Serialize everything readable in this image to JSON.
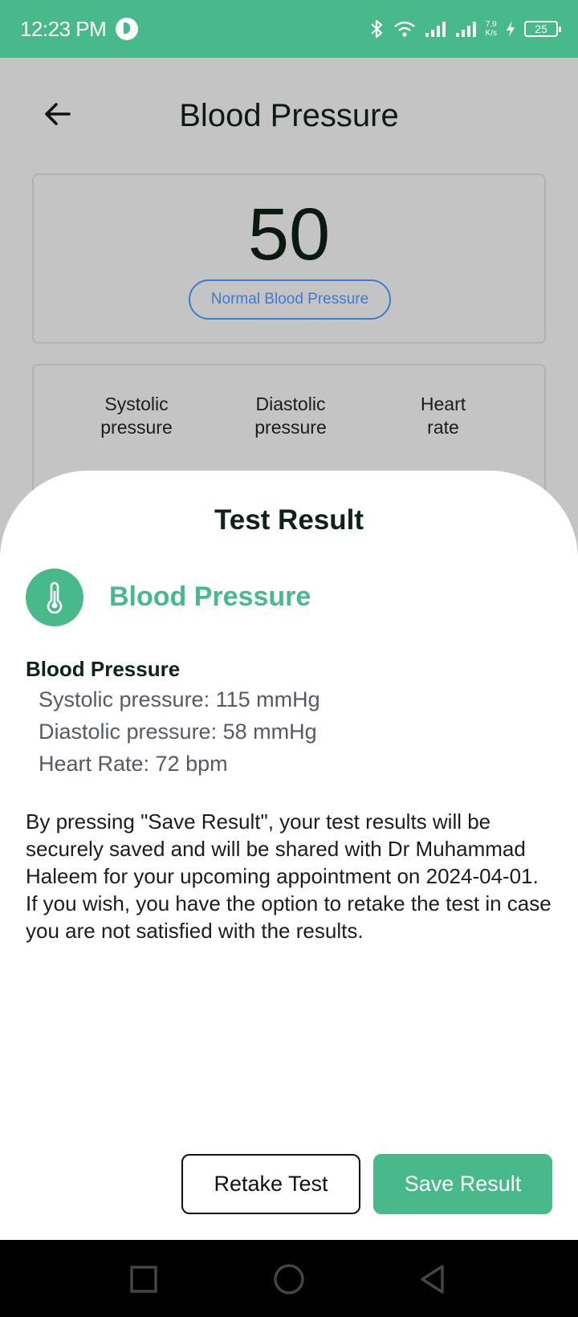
{
  "status_bar": {
    "time": "12:23 PM",
    "net_speed_value": "7.9",
    "net_speed_unit": "K/s",
    "battery": "25"
  },
  "header": {
    "title": "Blood Pressure"
  },
  "reading": {
    "value": "50",
    "status": "Normal Blood Pressure"
  },
  "metrics": {
    "labels": [
      "Systolic\npressure",
      "Diastolic\npressure",
      "Heart\nrate"
    ]
  },
  "sheet": {
    "title": "Test Result",
    "test_name": "Blood Pressure",
    "result_heading": "Blood Pressure",
    "results": [
      "Systolic pressure: 115 mmHg",
      "Diastolic pressure: 58 mmHg",
      "Heart Rate: 72 bpm"
    ],
    "disclaimer": "By pressing \"Save Result\", your test results will be securely saved and will be shared with Dr Muhammad Haleem for your upcoming appointment on 2024-04-01. If you wish, you have the option to retake the test in case you are not satisfied with the results.",
    "retake_label": "Retake Test",
    "save_label": "Save Result"
  },
  "colors": {
    "accent": "#48b98a",
    "badge": "#3d7bd0"
  },
  "icons": {
    "back": "arrow-left-icon",
    "test": "thermometer-icon",
    "nav": [
      "square-recents-icon",
      "circle-home-icon",
      "triangle-back-icon"
    ]
  }
}
